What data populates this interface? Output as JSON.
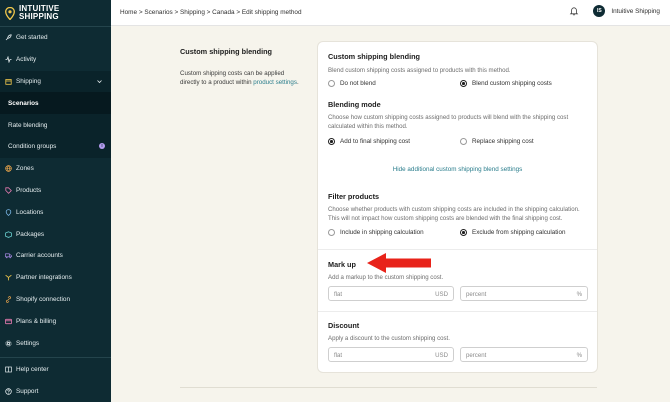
{
  "sidebar": {
    "logo_line1": "INTUITIVE",
    "logo_line2": "SHIPPING",
    "items": [
      {
        "label": "Get started",
        "icon": "rocket-icon"
      },
      {
        "label": "Activity",
        "icon": "activity-icon"
      },
      {
        "label": "Shipping",
        "icon": "box-icon"
      },
      {
        "label": "Scenarios"
      },
      {
        "label": "Rate blending"
      },
      {
        "label": "Condition groups",
        "badge": "!"
      },
      {
        "label": "Zones",
        "icon": "globe-icon"
      },
      {
        "label": "Products",
        "icon": "tag-icon"
      },
      {
        "label": "Locations",
        "icon": "pin-icon"
      },
      {
        "label": "Packages",
        "icon": "package-icon"
      },
      {
        "label": "Carrier accounts",
        "icon": "truck-icon"
      },
      {
        "label": "Partner integrations",
        "icon": "partner-icon"
      },
      {
        "label": "Shopify connection",
        "icon": "link-icon"
      },
      {
        "label": "Plans & billing",
        "icon": "card-icon"
      },
      {
        "label": "Settings",
        "icon": "gear-icon"
      }
    ],
    "bottom": [
      {
        "label": "Help center",
        "icon": "help-icon"
      },
      {
        "label": "Support",
        "icon": "support-icon"
      }
    ],
    "accent": "#f2c94c"
  },
  "topbar": {
    "breadcrumb": "Home > Scenarios > Shipping > Canada > Edit shipping method",
    "avatar": "IS",
    "user": "Intuitive Shipping"
  },
  "left": {
    "title": "Custom shipping blending",
    "desc": "Custom shipping costs can be applied directly to a product within ",
    "link": "product settings",
    "period": "."
  },
  "card": {
    "blending": {
      "title": "Custom shipping blending",
      "help": "Blend custom shipping costs assigned to products with this method.",
      "opt1": "Do not blend",
      "opt2": "Blend custom shipping costs",
      "selected": "opt2"
    },
    "mode": {
      "title": "Blending mode",
      "help": "Choose how custom shipping costs assigned to products will blend with the shipping cost calculated within this method.",
      "opt1": "Add to final shipping cost",
      "opt2": "Replace shipping cost",
      "selected": "opt1"
    },
    "hide_link": "Hide additional custom shipping blend settings",
    "filter": {
      "title": "Filter products",
      "help": "Choose whether products with custom shipping costs are included in the shipping calculation. This will not impact how custom shipping costs are blended with the final shipping cost.",
      "opt1": "Include in shipping calculation",
      "opt2": "Exclude from shipping calculation",
      "selected": "opt2"
    },
    "markup": {
      "title": "Mark up",
      "help": "Add a markup to the custom shipping cost.",
      "flat_placeholder": "flat",
      "flat_suffix": "USD",
      "pct_placeholder": "percent",
      "pct_suffix": "%"
    },
    "discount": {
      "title": "Discount",
      "help": "Apply a discount to the custom shipping cost.",
      "flat_placeholder": "flat",
      "flat_suffix": "USD",
      "pct_placeholder": "percent",
      "pct_suffix": "%"
    }
  },
  "colors": {
    "sidebar_bg": "#0e2b33",
    "link": "#2a7d8c",
    "annotation_arrow": "#e8231a"
  }
}
